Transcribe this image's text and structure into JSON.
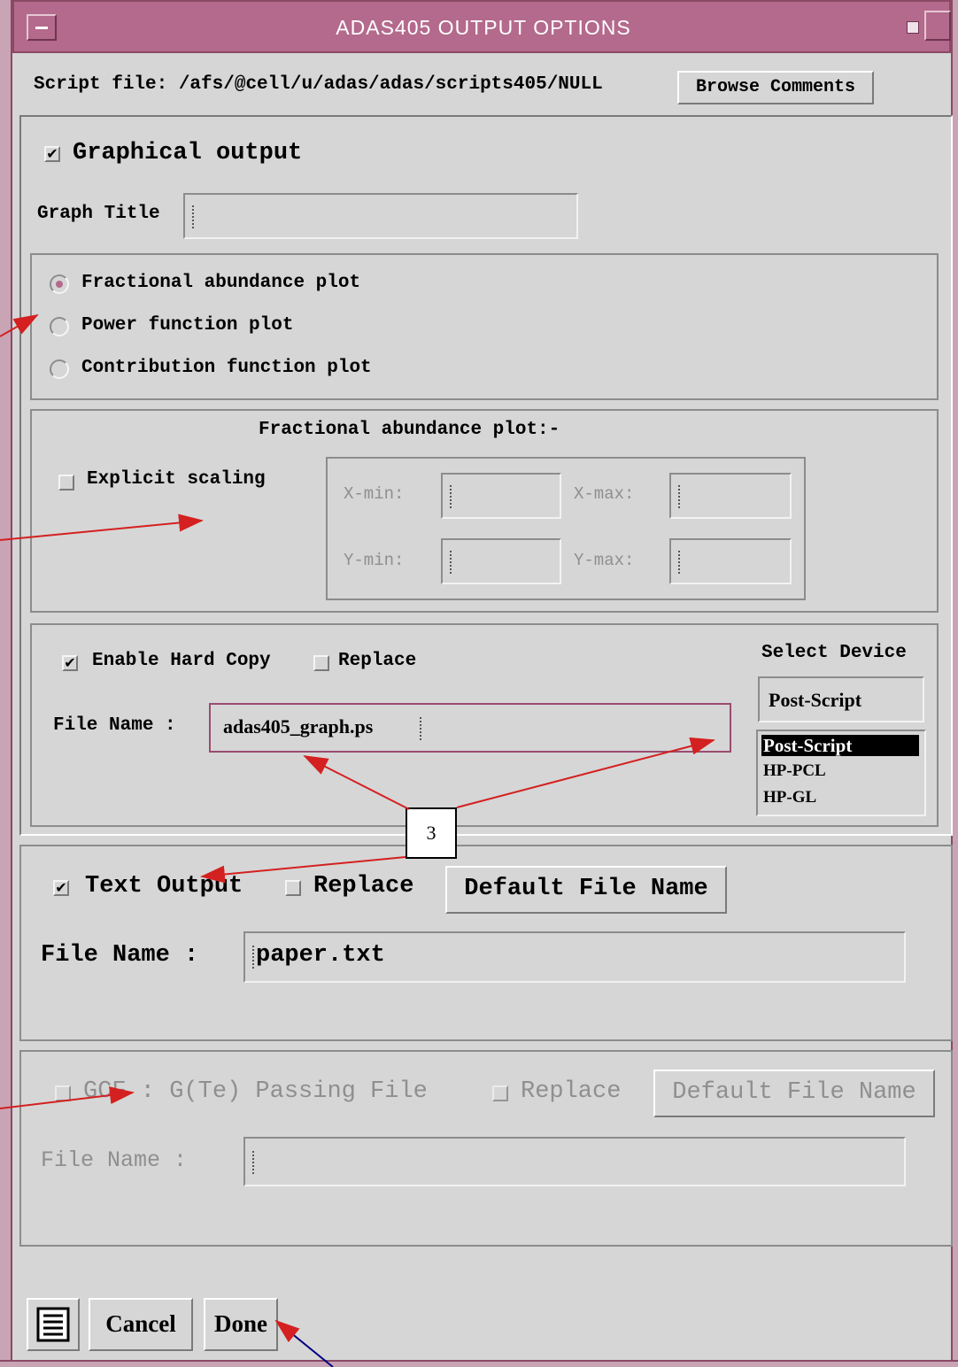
{
  "window": {
    "title": "ADAS405 OUTPUT OPTIONS"
  },
  "script": {
    "label": "Script file: /afs/@cell/u/adas/adas/scripts405/NULL",
    "browse_label": "Browse Comments"
  },
  "graphical": {
    "checkbox_label": "Graphical output",
    "checked": true,
    "title_label": "Graph Title",
    "title_value": "",
    "plot_options": [
      {
        "label": "Fractional abundance plot",
        "selected": true
      },
      {
        "label": "Power function plot",
        "selected": false
      },
      {
        "label": "Contribution function plot",
        "selected": false
      }
    ]
  },
  "scaling": {
    "heading": "Fractional abundance plot:-",
    "explicit_label": "Explicit scaling",
    "explicit_checked": false,
    "xmin_label": "X-min:",
    "xmax_label": "X-max:",
    "ymin_label": "Y-min:",
    "ymax_label": "Y-max:",
    "xmin": "",
    "xmax": "",
    "ymin": "",
    "ymax": ""
  },
  "hardcopy": {
    "enable_label": "Enable Hard Copy",
    "enable_checked": true,
    "replace_label": "Replace",
    "replace_checked": false,
    "file_label": "File Name :",
    "file_value": "adas405_graph.ps",
    "device_heading": "Select Device",
    "device_selected": "Post-Script",
    "devices": [
      "Post-Script",
      "HP-PCL",
      "HP-GL"
    ]
  },
  "annotation": {
    "callout_label": "3"
  },
  "text_output": {
    "checkbox_label": "Text Output",
    "checked": true,
    "replace_label": "Replace",
    "replace_checked": false,
    "default_label": "Default File Name",
    "file_label": "File Name :",
    "file_value": "paper.txt"
  },
  "gcf": {
    "checkbox_label": "GCF : G(Te) Passing File",
    "checked": false,
    "replace_label": "Replace",
    "default_label": "Default File Name",
    "file_label": "File Name :",
    "file_value": ""
  },
  "footer": {
    "cancel_label": "Cancel",
    "done_label": "Done"
  }
}
